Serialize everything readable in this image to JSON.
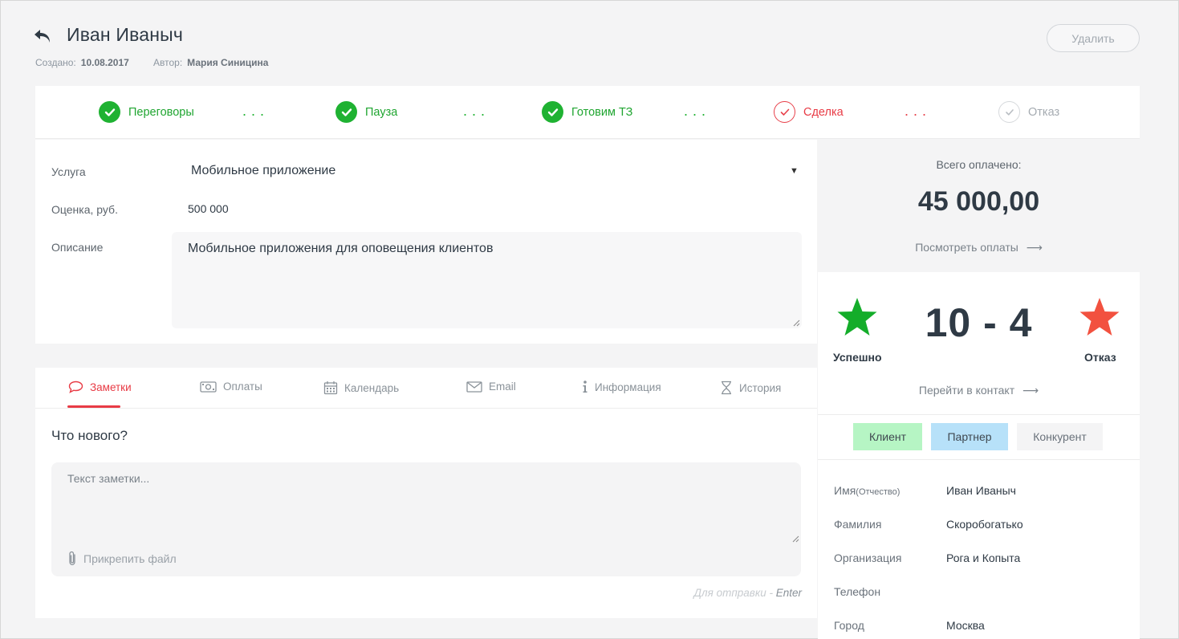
{
  "header": {
    "title": "Иван Иваныч",
    "created_label": "Создано:",
    "created_value": "10.08.2017",
    "author_label": "Автор:",
    "author_value": "Мария Синицина",
    "delete_label": "Удалить"
  },
  "stages": [
    {
      "label": "Переговоры",
      "state": "done"
    },
    {
      "label": "Пауза",
      "state": "done"
    },
    {
      "label": "Готовим ТЗ",
      "state": "done"
    },
    {
      "label": "Сделка",
      "state": "active"
    },
    {
      "label": "Отказ",
      "state": "pending"
    }
  ],
  "form": {
    "service_label": "Услуга",
    "service_value": "Мобильное приложение",
    "estimate_label": "Оценка, руб.",
    "estimate_value": "500 000",
    "description_label": "Описание",
    "description_value": "Мобильное приложения для оповещения клиентов"
  },
  "tabs": [
    {
      "label": "Заметки",
      "icon": "chat-bubble-icon",
      "active": true
    },
    {
      "label": "Оплаты",
      "icon": "banknote-icon",
      "active": false
    },
    {
      "label": "Календарь",
      "icon": "calendar-icon",
      "active": false
    },
    {
      "label": "Email",
      "icon": "envelope-icon",
      "active": false
    },
    {
      "label": "Информация",
      "icon": "info-icon",
      "active": false
    },
    {
      "label": "История",
      "icon": "hourglass-icon",
      "active": false
    }
  ],
  "notes": {
    "heading": "Что нового?",
    "placeholder": "Текст заметки...",
    "attach_label": "Прикрепить файл",
    "send_hint_prefix": "Для отправки - ",
    "send_hint_key": "Enter"
  },
  "payments": {
    "total_label": "Всего оплачено:",
    "total_value": "45 000,00",
    "view_link": "Посмотреть оплаты"
  },
  "score": {
    "value": "10 - 4",
    "success_label": "Успешно",
    "fail_label": "Отказ",
    "contact_link": "Перейти в контакт"
  },
  "contact_types": [
    {
      "label": "Клиент",
      "color": "#b6f5c4"
    },
    {
      "label": "Партнер",
      "color": "#b7e1f9"
    },
    {
      "label": "Конкурент",
      "color": "#f4f4f5"
    }
  ],
  "contact": {
    "first_name_label": "Имя",
    "patronymic_label": "(Отчество)",
    "first_name_value": "Иван Иваныч",
    "last_name_label": "Фамилия",
    "last_name_value": "Скоробогатько",
    "org_label": "Организация",
    "org_value": "Рога и Копыта",
    "phone_label": "Телефон",
    "phone_value": "",
    "city_label": "Город",
    "city_value": "Москва"
  },
  "colors": {
    "success": "#1fb232",
    "danger": "#e83b45",
    "star_success": "#14ad2a",
    "star_fail": "#f2513f"
  }
}
